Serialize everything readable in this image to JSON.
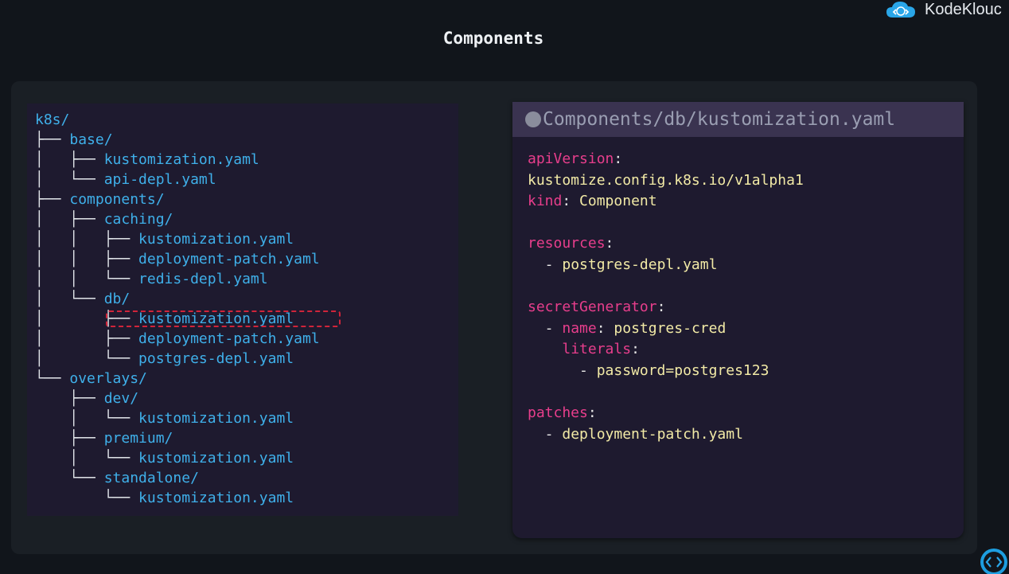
{
  "brand": {
    "name": "KodeKlouc",
    "logo_icon": "cloud-code-icon"
  },
  "slide": {
    "title": "Components"
  },
  "tree": {
    "lines": [
      {
        "conn": "",
        "text": "k8s/"
      },
      {
        "conn": "├── ",
        "text": "base/"
      },
      {
        "conn": "│   ├── ",
        "text": "kustomization.yaml"
      },
      {
        "conn": "│   └── ",
        "text": "api-depl.yaml"
      },
      {
        "conn": "├── ",
        "text": "components/"
      },
      {
        "conn": "│   ├── ",
        "text": "caching/"
      },
      {
        "conn": "│   │   ├── ",
        "text": "kustomization.yaml"
      },
      {
        "conn": "│   │   ├── ",
        "text": "deployment-patch.yaml"
      },
      {
        "conn": "│   │   └── ",
        "text": "redis-depl.yaml"
      },
      {
        "conn": "│   └── ",
        "text": "db/"
      },
      {
        "conn": "│       ├── ",
        "text": "kustomization.yaml"
      },
      {
        "conn": "│       ├── ",
        "text": "deployment-patch.yaml"
      },
      {
        "conn": "│       └── ",
        "text": "postgres-depl.yaml"
      },
      {
        "conn": "└── ",
        "text": "overlays/"
      },
      {
        "conn": "    ├── ",
        "text": "dev/"
      },
      {
        "conn": "    │   └── ",
        "text": "kustomization.yaml"
      },
      {
        "conn": "    ├── ",
        "text": "premium/"
      },
      {
        "conn": "    │   └── ",
        "text": "kustomization.yaml"
      },
      {
        "conn": "    └── ",
        "text": "standalone/"
      },
      {
        "conn": "        └── ",
        "text": "kustomization.yaml"
      }
    ]
  },
  "editor": {
    "filename": "Components/db/kustomization.yaml",
    "code": [
      [
        {
          "t": "k",
          "s": "apiVersion"
        },
        {
          "t": "p",
          "s": ":"
        }
      ],
      [
        {
          "t": "v",
          "s": "kustomize.config.k8s.io/v1alpha1"
        }
      ],
      [
        {
          "t": "k",
          "s": "kind"
        },
        {
          "t": "p",
          "s": ": "
        },
        {
          "t": "v",
          "s": "Component"
        }
      ],
      [],
      [
        {
          "t": "k",
          "s": "resources"
        },
        {
          "t": "p",
          "s": ":"
        }
      ],
      [
        {
          "t": "p",
          "s": "  - "
        },
        {
          "t": "v",
          "s": "postgres-depl.yaml"
        }
      ],
      [],
      [
        {
          "t": "k",
          "s": "secretGenerator"
        },
        {
          "t": "p",
          "s": ":"
        }
      ],
      [
        {
          "t": "p",
          "s": "  - "
        },
        {
          "t": "k",
          "s": "name"
        },
        {
          "t": "p",
          "s": ": "
        },
        {
          "t": "v",
          "s": "postgres-cred"
        }
      ],
      [
        {
          "t": "p",
          "s": "    "
        },
        {
          "t": "k",
          "s": "literals"
        },
        {
          "t": "p",
          "s": ":"
        }
      ],
      [
        {
          "t": "p",
          "s": "      - "
        },
        {
          "t": "v",
          "s": "password=postgres123"
        }
      ],
      [],
      [
        {
          "t": "k",
          "s": "patches"
        },
        {
          "t": "p",
          "s": ":"
        }
      ],
      [
        {
          "t": "p",
          "s": "  - "
        },
        {
          "t": "v",
          "s": "deployment-patch.yaml"
        }
      ]
    ]
  },
  "colors": {
    "tree_text": "#3fb0ea",
    "key": "#e83e8c",
    "value": "#f2eaa6",
    "highlight_border": "#d0243a"
  },
  "badge": {
    "icon": "code-brackets-icon"
  }
}
